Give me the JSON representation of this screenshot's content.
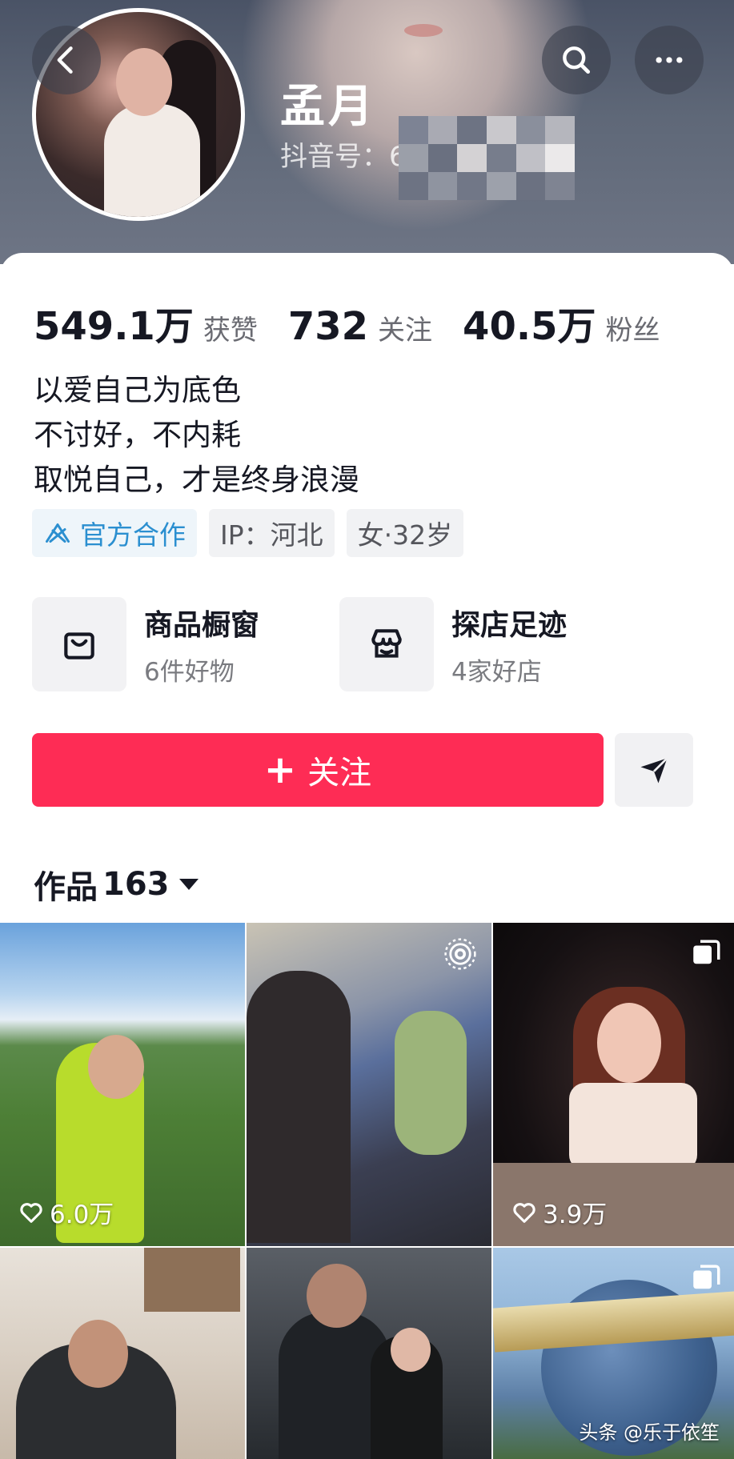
{
  "profile": {
    "name": "孟月",
    "douyin_id_label": "抖音号：6"
  },
  "stats": [
    {
      "num": "549.1万",
      "label": "获赞"
    },
    {
      "num": "732",
      "label": "关注"
    },
    {
      "num": "40.5万",
      "label": "粉丝"
    }
  ],
  "bio": [
    "以爱自己为底色",
    "不讨好，不内耗",
    "取悦自己，才是终身浪漫"
  ],
  "tags": {
    "official": "官方合作",
    "ip": "IP：河北",
    "gender_age": "女·32岁"
  },
  "shops": [
    {
      "title": "商品橱窗",
      "sub": "6件好物"
    },
    {
      "title": "探店足迹",
      "sub": "4家好店"
    }
  ],
  "follow_label": "关注",
  "works": {
    "label": "作品",
    "count": "163"
  },
  "grid": [
    {
      "likes": "6.0万"
    },
    {},
    {
      "likes": "3.9万"
    },
    {},
    {},
    {}
  ],
  "watermark": "头条 @乐于依笙",
  "colors": {
    "accent": "#fe2c55",
    "official": "#2b8fd0"
  }
}
